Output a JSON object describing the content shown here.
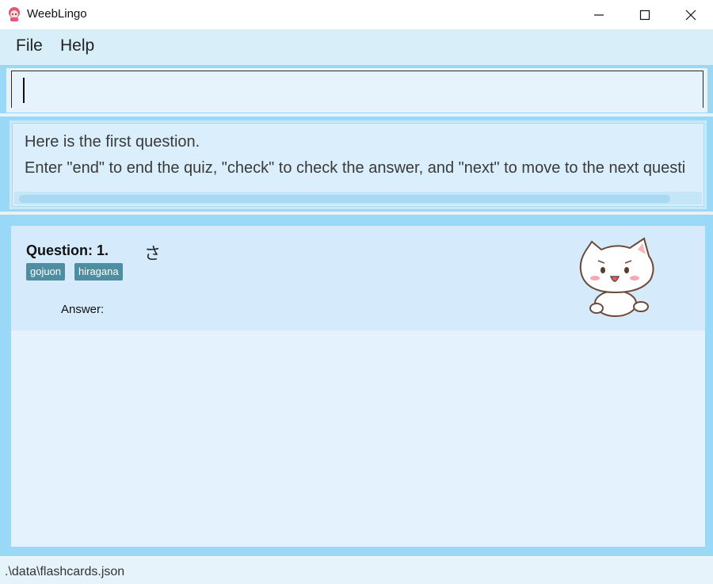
{
  "window": {
    "title": "WeebLingo",
    "icon": "app-girl-icon",
    "controls": [
      "minimize-icon",
      "maximize-icon",
      "close-icon"
    ]
  },
  "menu": {
    "file_label": "File",
    "help_label": "Help"
  },
  "command": {
    "value": "",
    "placeholder": ""
  },
  "result": {
    "line1": "Here is the first question.",
    "line2": "Enter \"end\" to end the quiz, \"check\" to check the answer, and \"next\" to move to the next questi"
  },
  "card": {
    "title": "Question: 1.",
    "question": "さ",
    "tags": [
      "gojuon",
      "hiragana"
    ],
    "answer_label": "Answer:",
    "mascot": "cat-mascot-image"
  },
  "status": {
    "path": ".\\data\\flashcards.json"
  },
  "colors": {
    "accent": "#99d8f6",
    "menu_bg": "#d8eef9",
    "card_bg": "#d5eafb",
    "tag_bg": "#4e8ea0"
  }
}
